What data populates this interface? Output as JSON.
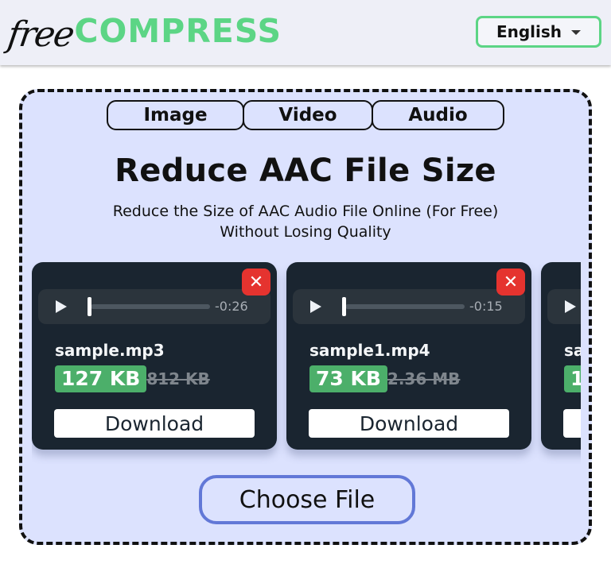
{
  "header": {
    "logo_free": "free",
    "logo_compress": "COMPRESS",
    "language": "English"
  },
  "tabs": [
    {
      "label": "Image"
    },
    {
      "label": "Video"
    },
    {
      "label": "Audio"
    }
  ],
  "title": "Reduce AAC File Size",
  "subtitle_line1": "Reduce the Size of AAC Audio File Online (For Free)",
  "subtitle_line2": "Without Losing Quality",
  "cards": [
    {
      "filename": "sample.mp3",
      "remaining_time": "-0:26",
      "new_size": "127 KB",
      "old_size": "812 KB",
      "download_label": "Download",
      "progress": 0
    },
    {
      "filename": "sample1.mp4",
      "remaining_time": "-0:15",
      "new_size": "73 KB",
      "old_size": "2.36 MB",
      "download_label": "Download",
      "progress": 0
    },
    {
      "filename": "sa",
      "new_size": "1",
      "download_label": ""
    }
  ],
  "choose_file_label": "Choose File",
  "icons": {
    "close": "✕",
    "play": "play-triangle",
    "caret": "caret-down"
  },
  "colors": {
    "brand_green": "#5cd585",
    "panel_bg": "#dce2fe",
    "card_bg": "#1a2530",
    "close_red": "#e5332f",
    "size_badge_green": "#4caf6a",
    "choose_border": "#6278d7"
  }
}
